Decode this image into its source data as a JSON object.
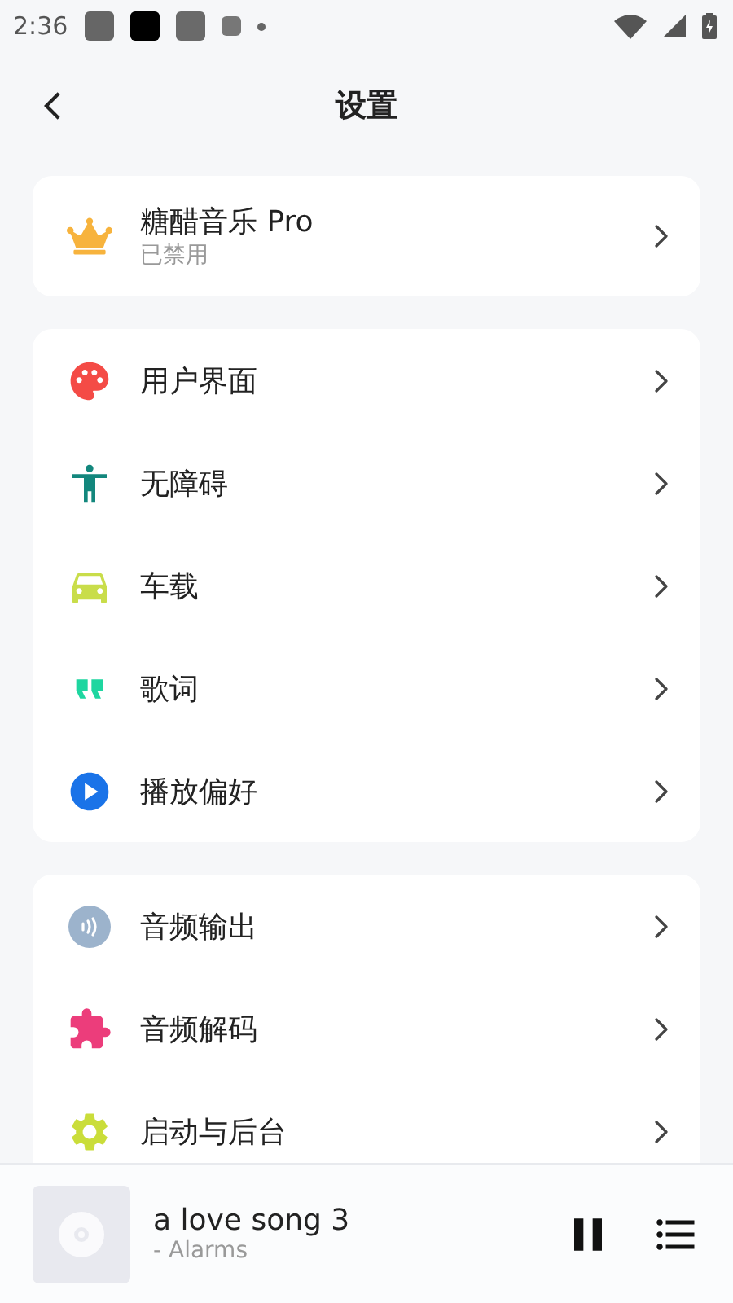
{
  "status_bar": {
    "time": "2:36"
  },
  "header": {
    "title": "设置"
  },
  "pro_card": {
    "title": "糖醋音乐 Pro",
    "subtitle": "已禁用"
  },
  "groups": [
    {
      "items": [
        {
          "label": "用户界面",
          "kind": "palette",
          "color": "#f44b46"
        },
        {
          "label": "无障碍",
          "kind": "accessibility",
          "color": "#13877d"
        },
        {
          "label": "车载",
          "kind": "car",
          "color": "#c9dd4a"
        },
        {
          "label": "歌词",
          "kind": "quote",
          "color": "#1ed6a0"
        },
        {
          "label": "播放偏好",
          "kind": "play",
          "color": "#1a73e8"
        }
      ]
    },
    {
      "items": [
        {
          "label": "音频输出",
          "kind": "audio",
          "color": "#9cb3cc"
        },
        {
          "label": "音频解码",
          "kind": "puzzle",
          "color": "#ec3d7b"
        },
        {
          "label": "启动与后台",
          "kind": "gear",
          "color": "#cadd3a"
        }
      ]
    }
  ],
  "player": {
    "title": "a love song 3",
    "artist": "- Alarms"
  }
}
